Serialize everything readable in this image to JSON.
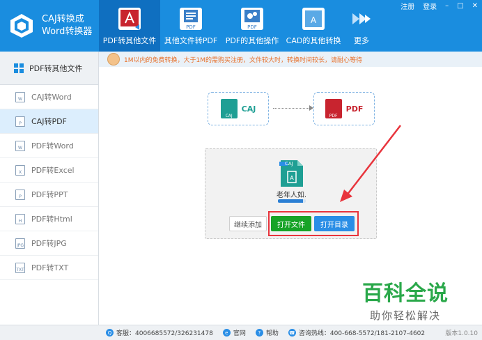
{
  "app": {
    "title_line1": "CAJ转换成",
    "title_line2": "Word转换器"
  },
  "nav": [
    {
      "label": "PDF转其他文件",
      "icon": "pdf-acrobat-icon"
    },
    {
      "label": "其他文件转PDF",
      "icon": "pdf-page-icon"
    },
    {
      "label": "PDF的其他操作",
      "icon": "pdf-gear-icon"
    },
    {
      "label": "CAD的其他转换",
      "icon": "cad-icon"
    },
    {
      "label": "更多",
      "icon": "double-chevron-icon"
    }
  ],
  "window": {
    "register": "注册",
    "login": "登录",
    "minimize": "–",
    "maximize": "□",
    "close": "✕"
  },
  "sidebar": {
    "header": "PDF转其他文件",
    "items": [
      {
        "label": "CAJ转Word",
        "tag": "W"
      },
      {
        "label": "CAJ转PDF",
        "tag": "P"
      },
      {
        "label": "PDF转Word",
        "tag": "W"
      },
      {
        "label": "PDF转Excel",
        "tag": "X"
      },
      {
        "label": "PDF转PPT",
        "tag": "P"
      },
      {
        "label": "PDF转Html",
        "tag": "H"
      },
      {
        "label": "PDF转JPG",
        "tag": "JPG"
      },
      {
        "label": "PDF转TXT",
        "tag": "TXT"
      }
    ]
  },
  "notice": "1M以内的免费转换，大于1M的需购买注册，文件较大时，转换时间较长，请耐心等待",
  "flow": {
    "from_label": "CAJ",
    "to_label": "PDF",
    "from_icon_text": "CAJ",
    "to_icon_text": "PDF"
  },
  "file": {
    "name": "老年人如.",
    "icon_text": "CAJ",
    "progress": 0.9
  },
  "buttons": {
    "add": "继续添加",
    "open_file": "打开文件",
    "open_dir": "打开目录"
  },
  "watermark": {
    "title": "百科全说",
    "subtitle": "助你轻松解决"
  },
  "status": {
    "qq": "客服：4006685572/326231478",
    "site": "官网",
    "help": "帮助",
    "hotline": "咨询热线：400-668-5572/181-2107-4602",
    "version": "版本1.0.10"
  },
  "colors": {
    "header": "#1a8ddf",
    "nav_active": "#0f6fc0",
    "green": "#17a327",
    "blue": "#2a8ee6",
    "highlight": "#e8343c",
    "caj": "#1f9f94",
    "pdf": "#c8242f"
  }
}
